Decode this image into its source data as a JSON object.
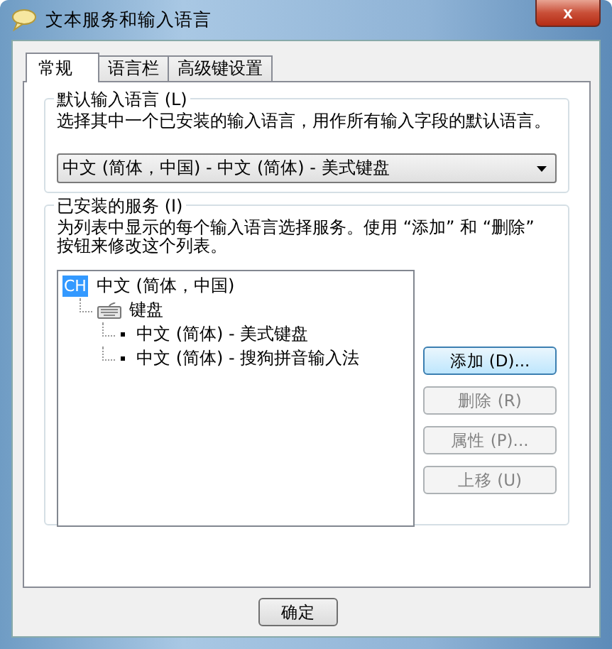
{
  "window": {
    "title": "文本服务和输入语言",
    "close": "x"
  },
  "tabs": [
    {
      "label": "常规",
      "selected": true
    },
    {
      "label": "语言栏",
      "selected": false
    },
    {
      "label": "高级键设置",
      "selected": false
    }
  ],
  "default_language": {
    "label": "默认输入语言 (L)",
    "description": "选择其中一个已安装的输入语言，用作所有输入字段的默认语言。",
    "value": "中文 (简体，中国) - 中文 (简体) - 美式键盘"
  },
  "installed_services": {
    "label": "已安装的服务 (I)",
    "description": "为列表中显示的每个输入语言选择服务。使用 “添加” 和 “删除” 按钮来修改这个列表。",
    "tree": [
      {
        "badge": "CH",
        "label": "中文 (简体，中国)",
        "selected": false,
        "children": [
          {
            "label": "键盘",
            "selected": false,
            "children": [
              {
                "label": "中文 (简体) - 美式键盘",
                "selected": false
              },
              {
                "label": "中文 (简体) - 搜狗拼音输入法",
                "selected": false
              }
            ]
          }
        ]
      }
    ],
    "buttons": [
      {
        "label": "添加 (D)...",
        "disabled": false
      },
      {
        "label": "删除 (R)",
        "disabled": true
      },
      {
        "label": "属性 (P)...",
        "disabled": true
      },
      {
        "label": "上移 (U)",
        "disabled": true
      }
    ]
  },
  "footer_buttons": [
    "确定"
  ]
}
